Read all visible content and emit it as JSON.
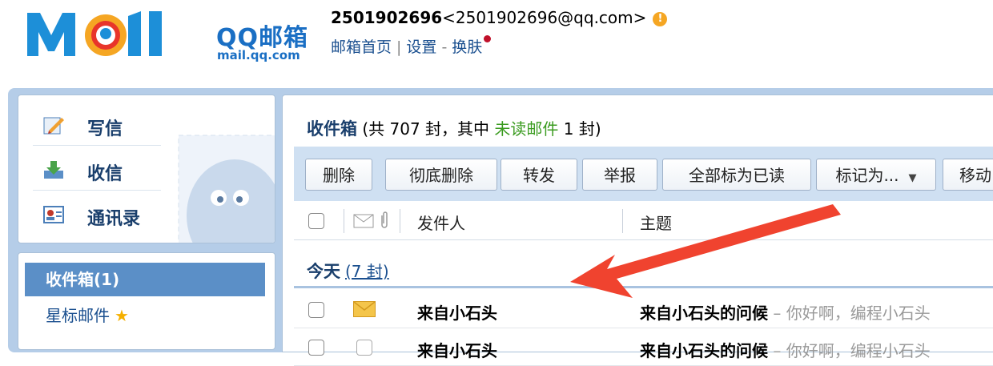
{
  "header": {
    "logo_cn": "QQ邮箱",
    "logo_en": "mail.qq.com",
    "user_id": "2501902696",
    "user_email": "<2501902696@qq.com>",
    "warning_icon": "exclamation-icon",
    "links": [
      "邮箱首页",
      "设置",
      "换肤"
    ],
    "sep1": "|",
    "sep2": "-"
  },
  "sidebar": {
    "actions": [
      {
        "label": "写信",
        "icon": "compose-icon"
      },
      {
        "label": "收信",
        "icon": "receive-icon"
      },
      {
        "label": "通讯录",
        "icon": "contacts-icon"
      }
    ],
    "folders": [
      {
        "label": "收件箱(1)",
        "selected": true
      },
      {
        "label": "星标邮件",
        "star": "★"
      }
    ]
  },
  "main": {
    "title": "收件箱",
    "count_prefix": " (共 707 封，其中 ",
    "unread_label": "未读邮件",
    "count_suffix": " 1 封)",
    "toolbar": [
      "删除",
      "彻底删除",
      "转发",
      "举报",
      "全部标为已读",
      "标记为...",
      "移动"
    ],
    "columns": {
      "sender": "发件人",
      "subject": "主题"
    },
    "group": {
      "label": "今天",
      "count": "(7 封)"
    },
    "rows": [
      {
        "sender": "来自小石头",
        "subject": "来自小石头的问候",
        "preview": " – 你好啊，编程小石头"
      },
      {
        "sender": "来自小石头",
        "subject": "来自小石头的问候",
        "preview": " – 你好啊，编程小石头"
      }
    ]
  },
  "colors": {
    "accent": "#1a6fc4",
    "arrow": "#f0432f",
    "selected": "#5b8fc7"
  }
}
